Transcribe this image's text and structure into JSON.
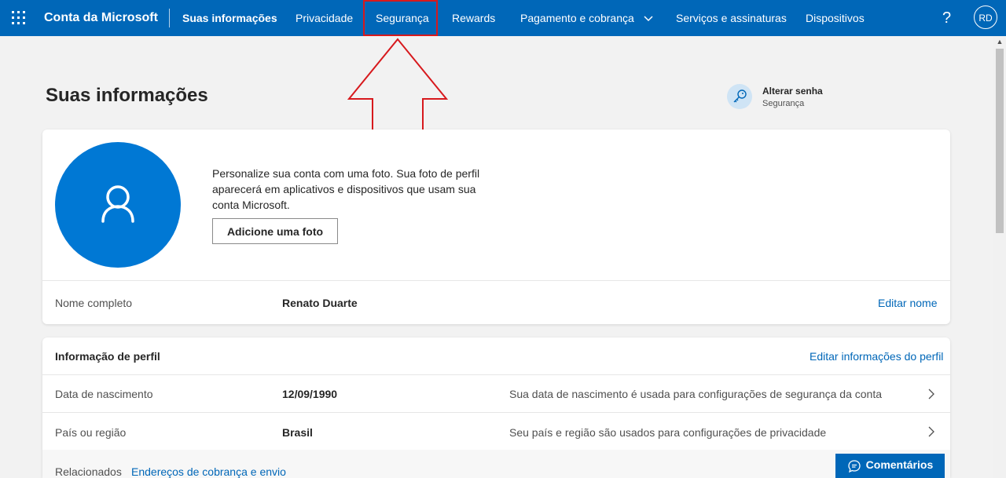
{
  "app": {
    "brand": "Conta da Microsoft"
  },
  "nav": {
    "items": [
      {
        "label": "Suas informações"
      },
      {
        "label": "Privacidade"
      },
      {
        "label": "Segurança"
      },
      {
        "label": "Rewards"
      },
      {
        "label": "Pagamento e cobrança"
      },
      {
        "label": "Serviços e assinaturas"
      },
      {
        "label": "Dispositivos"
      }
    ],
    "help": "?",
    "user_initials": "RD"
  },
  "page": {
    "title": "Suas informações"
  },
  "password_shortcut": {
    "title": "Alterar senha",
    "subtitle": "Segurança",
    "icon": "key-icon"
  },
  "photo": {
    "description": "Personalize sua conta com uma foto. Sua foto de perfil aparecerá em aplicativos e dispositivos que usam sua conta Microsoft.",
    "button": "Adicione uma foto"
  },
  "full_name": {
    "label": "Nome completo",
    "value": "Renato Duarte",
    "action": "Editar nome"
  },
  "profile": {
    "title": "Informação de perfil",
    "edit": "Editar informações do perfil",
    "rows": [
      {
        "label": "Data de nascimento",
        "value": "12/09/1990",
        "description": "Sua data de nascimento é usada para configurações de segurança da conta"
      },
      {
        "label": "País ou região",
        "value": "Brasil",
        "description": "Seu país e região são usados para configurações de privacidade"
      }
    ],
    "related_label": "Relacionados",
    "related_link": "Endereços de cobrança e envio"
  },
  "feedback": {
    "label": "Comentários"
  },
  "colors": {
    "brand": "#0067b8",
    "highlight": "#d7191d",
    "avatar": "#0078d4"
  }
}
